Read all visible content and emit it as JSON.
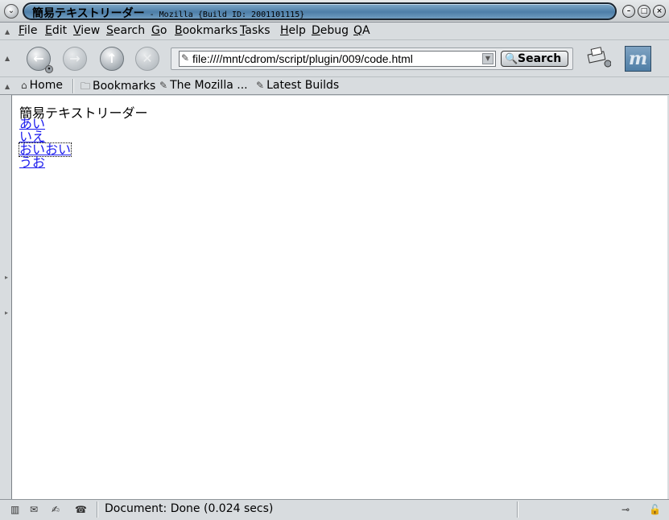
{
  "window": {
    "title_main": "簡易テキストリーダー",
    "title_rest": " - Mozilla {Build ID: 2001101115}"
  },
  "menu": [
    "File",
    "Edit",
    "View",
    "Search",
    "Go",
    "Bookmarks",
    "Tasks",
    "Help",
    "Debug",
    "QA"
  ],
  "nav": {
    "url": "file:////mnt/cdrom/script/plugin/009/code.html",
    "search_label": "Search"
  },
  "personal_toolbar": {
    "home": "Home",
    "bookmarks": "Bookmarks",
    "mozilla": "The Mozilla ...",
    "latest": "Latest Builds"
  },
  "page": {
    "heading": "簡易テキストリーダー",
    "links": [
      "あい",
      "いえ",
      "おいおい",
      "うお"
    ]
  },
  "status": {
    "text": "Document: Done (0.024 secs)"
  },
  "colors": {
    "link": "#1a1aee",
    "titlebar_accent": "#4d7ea8"
  }
}
